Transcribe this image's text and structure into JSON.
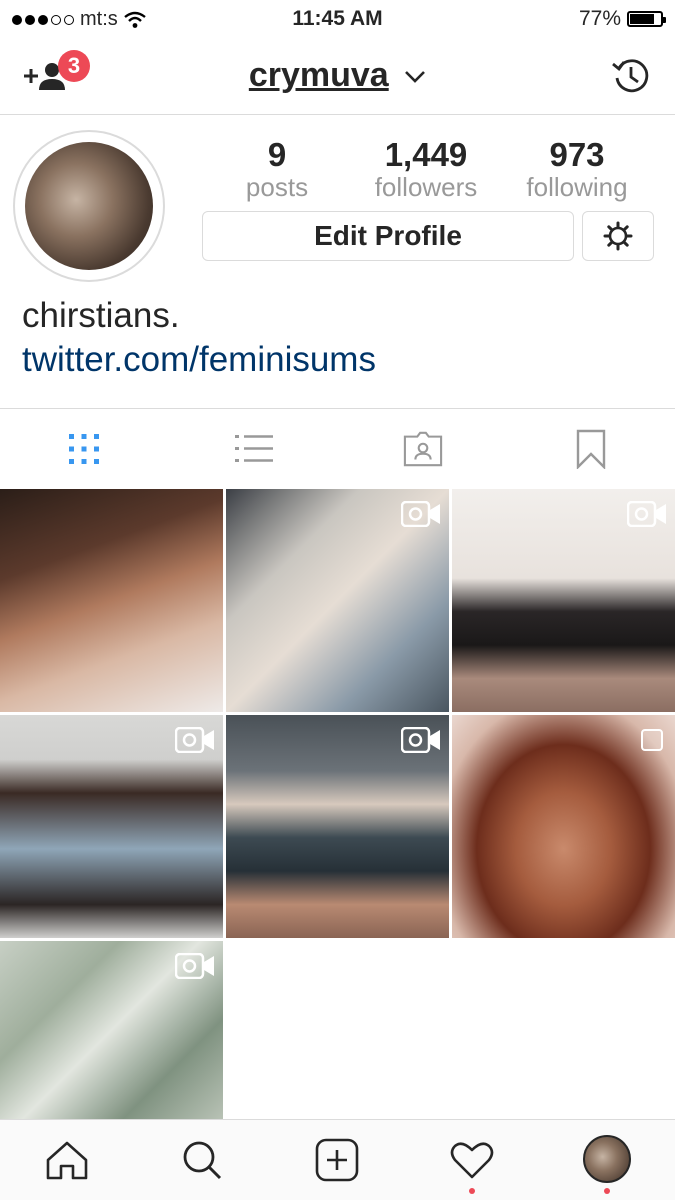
{
  "status_bar": {
    "carrier": "mt:s",
    "time": "11:45 AM",
    "battery": "77%",
    "battery_level": 0.77
  },
  "header": {
    "username": "crymuva",
    "notification_count": "3"
  },
  "stats": [
    {
      "value": "9",
      "label": "posts"
    },
    {
      "value": "1,449",
      "label": "followers"
    },
    {
      "value": "973",
      "label": "following"
    }
  ],
  "edit_profile_label": "Edit Profile",
  "bio": {
    "name": "chirstians.",
    "link": "twitter.com/feminisums"
  },
  "tabs": [
    "grid-icon",
    "list-icon",
    "tagged-icon",
    "saved-icon"
  ],
  "active_tab": "grid-icon",
  "accent_color": "#3897f0",
  "posts": [
    {
      "type": "photo"
    },
    {
      "type": "video"
    },
    {
      "type": "video"
    },
    {
      "type": "video"
    },
    {
      "type": "video"
    },
    {
      "type": "carousel"
    },
    {
      "type": "video"
    }
  ],
  "bottom_nav": [
    "home-icon",
    "search-icon",
    "add-post-icon",
    "activity-heart-icon",
    "profile-avatar"
  ]
}
